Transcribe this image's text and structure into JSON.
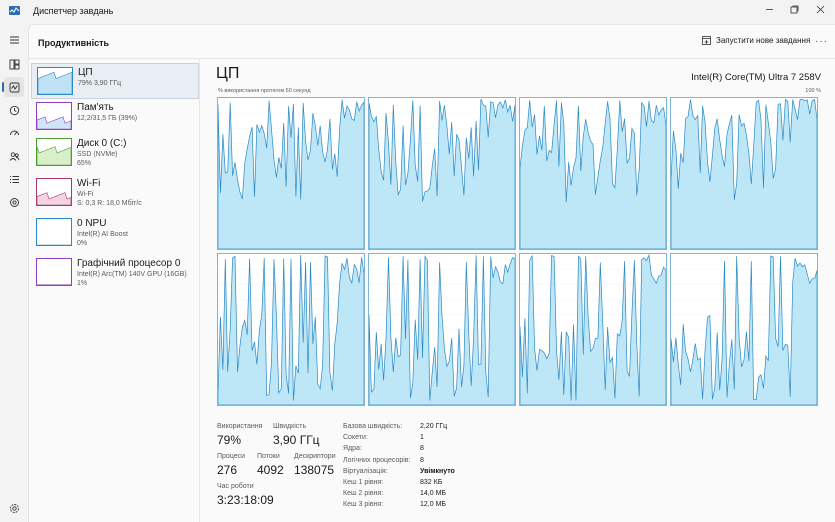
{
  "window": {
    "title": "Диспетчер завдань"
  },
  "header": {
    "title": "Продуктивність",
    "run_new_task": "Запустити нове завдання",
    "more": "···"
  },
  "rail": {
    "items": [
      "menu-icon",
      "processes-icon",
      "performance-icon",
      "history-icon",
      "startup-icon",
      "users-icon",
      "details-icon",
      "services-icon",
      "settings-icon"
    ]
  },
  "devices": [
    {
      "name": "ЦП",
      "sub1": "79% 3,90 ГГц",
      "sub2": "",
      "sub3": "",
      "color": "#2a89c6",
      "fill": "#bfe3f5",
      "level": 0.79
    },
    {
      "name": "Пам'ять",
      "sub1": "12,2/31,5 ГБ (39%)",
      "sub2": "",
      "sub3": "",
      "color": "#8f3fc0",
      "fill": "#cfe5f5",
      "level": 0.39
    },
    {
      "name": "Диск 0 (C:)",
      "sub1": "SSD (NVMe)",
      "sub2": "65%",
      "sub3": "",
      "color": "#4c9d2f",
      "fill": "#d9efc9",
      "level": 0.65
    },
    {
      "name": "Wi-Fi",
      "sub1": "Wi-Fi",
      "sub2": "S: 0,3 R: 18,0 Мбіт/с",
      "sub3": "",
      "color": "#a83a6b",
      "fill": "#f4d3e3",
      "level": 0.4
    },
    {
      "name": "0 NPU",
      "sub1": "Intel(R) AI Boost",
      "sub2": "0%",
      "sub3": "",
      "color": "#2a89c6",
      "fill": "#ffffff",
      "level": 0.0
    },
    {
      "name": "Графічний процесор 0",
      "sub1": "Intel(R) Arc(TM) 140V GPU (16GB)",
      "sub2": "1%",
      "sub3": "",
      "color": "#8f3fc0",
      "fill": "#ffffff",
      "level": 0.01
    }
  ],
  "cpu": {
    "title": "ЦП",
    "model": "Intel(R) Core(TM) Ultra 7 258V",
    "axis_left": "% використання протягом 60 секунд",
    "axis_right": "100 %",
    "stats": {
      "usage_label": "Використання",
      "usage_value": "79%",
      "speed_label": "Швидкість",
      "speed_value": "3,90 ГГц",
      "processes_label": "Процеси",
      "processes_value": "276",
      "threads_label": "Потоки",
      "threads_value": "4092",
      "handles_label": "Дескриптори",
      "handles_value": "138075",
      "uptime_label": "Час роботи",
      "uptime_value": "3:23:18:09"
    },
    "specs": [
      {
        "label": "Базова швидкість:",
        "value": "2,20 ГГц"
      },
      {
        "label": "Сокети:",
        "value": "1"
      },
      {
        "label": "Ядра:",
        "value": "8"
      },
      {
        "label": "Логічних процесорів:",
        "value": "8"
      },
      {
        "label": "Віртуалізація:",
        "value": "Увімкнуто"
      },
      {
        "label": "Кеш 1 рівня:",
        "value": "832 КБ"
      },
      {
        "label": "Кеш 2 рівня:",
        "value": "14,0 МБ"
      },
      {
        "label": "Кеш 3 рівня:",
        "value": "12,0 МБ"
      }
    ]
  },
  "colors": {
    "cpu_line": "#2a89c6",
    "cpu_fill": "#bde6f6"
  }
}
